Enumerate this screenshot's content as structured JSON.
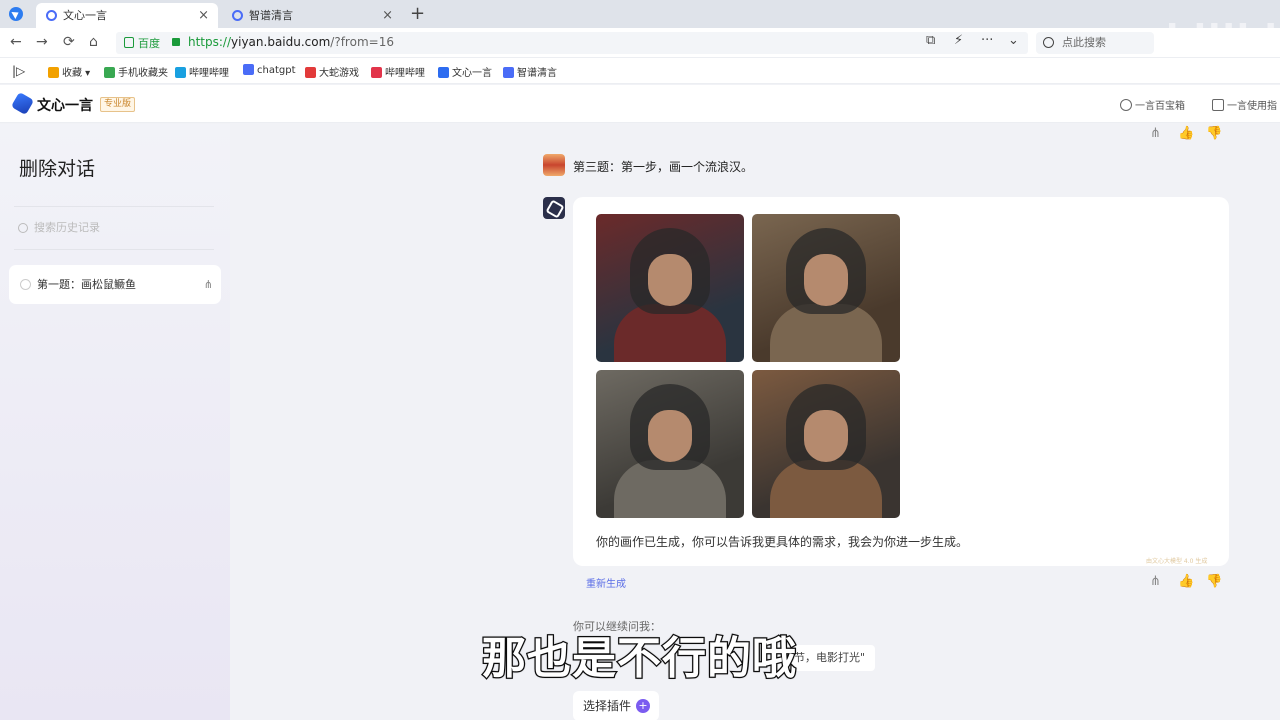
{
  "browser": {
    "tabs": [
      {
        "label": "文心一言",
        "close": "×"
      },
      {
        "label": "智谱清言",
        "close": "×"
      }
    ],
    "new_tab": "+",
    "nav": {
      "back": "←",
      "forward": "→",
      "reload": "⟳",
      "home": "⌂"
    },
    "secure_label": "百度",
    "url_proto": "https://",
    "url_host": "yiyan.baidu.com",
    "url_rest": "/?from=16",
    "tools": {
      "screenshot": "⧉",
      "bolt": "⚡",
      "more": "···",
      "dropdown": "⌄"
    },
    "search_text": "点此搜索",
    "bookmarks_toggle": "|▷",
    "bookmarks": [
      {
        "label": "收藏",
        "color": "#f2a100"
      },
      {
        "label": "手机收藏夹",
        "color": "#39a852"
      },
      {
        "label": "哔哩哔哩",
        "color": "#19a0e0"
      },
      {
        "label": "chatgpt",
        "color": "#4a6cf7"
      },
      {
        "label": "大蛇游戏",
        "color": "#e23a3a"
      },
      {
        "label": "哔哩哔哩",
        "color": "#e2344a"
      },
      {
        "label": "文心一言",
        "color": "#2d6cf0"
      },
      {
        "label": "智谱清言",
        "color": "#4a6cf7"
      }
    ]
  },
  "app": {
    "logo_text": "文心一言",
    "badge": "专业版",
    "header_links": [
      "一言百宝箱",
      "一言使用指"
    ]
  },
  "sidebar": {
    "title": "删除对话",
    "search_placeholder": "搜索历史记录",
    "items": [
      {
        "label": "第一题：画松鼠鳜鱼",
        "share": "⋔"
      }
    ]
  },
  "chat": {
    "actions": {
      "share": "⋔",
      "like": "👍",
      "dislike": "👎"
    },
    "user_message": "第三题：第一步，画一个流浪汉。",
    "bot_text": "你的画作已生成，你可以告诉我更具体的需求，我会为你进一步生成。",
    "watermark": "由文心大模型 4.0 生成",
    "regenerate": "重新生成",
    "suggest_label": "你可以继续问我：",
    "suggest_chip": "节，电影打光\"",
    "plugin_button": "选择插件",
    "plugin_plus": "+",
    "images": [
      {
        "bg": "#2a3440",
        "accent": "#6b2a2a"
      },
      {
        "bg": "#4a3a2c",
        "accent": "#7a6650"
      },
      {
        "bg": "#3c3a36",
        "accent": "#6e6a62"
      },
      {
        "bg": "#3a3430",
        "accent": "#7c5a40"
      }
    ]
  },
  "overlay": {
    "subtitle": "那也是不行的哦",
    "corner_watermark": "bilibili"
  }
}
